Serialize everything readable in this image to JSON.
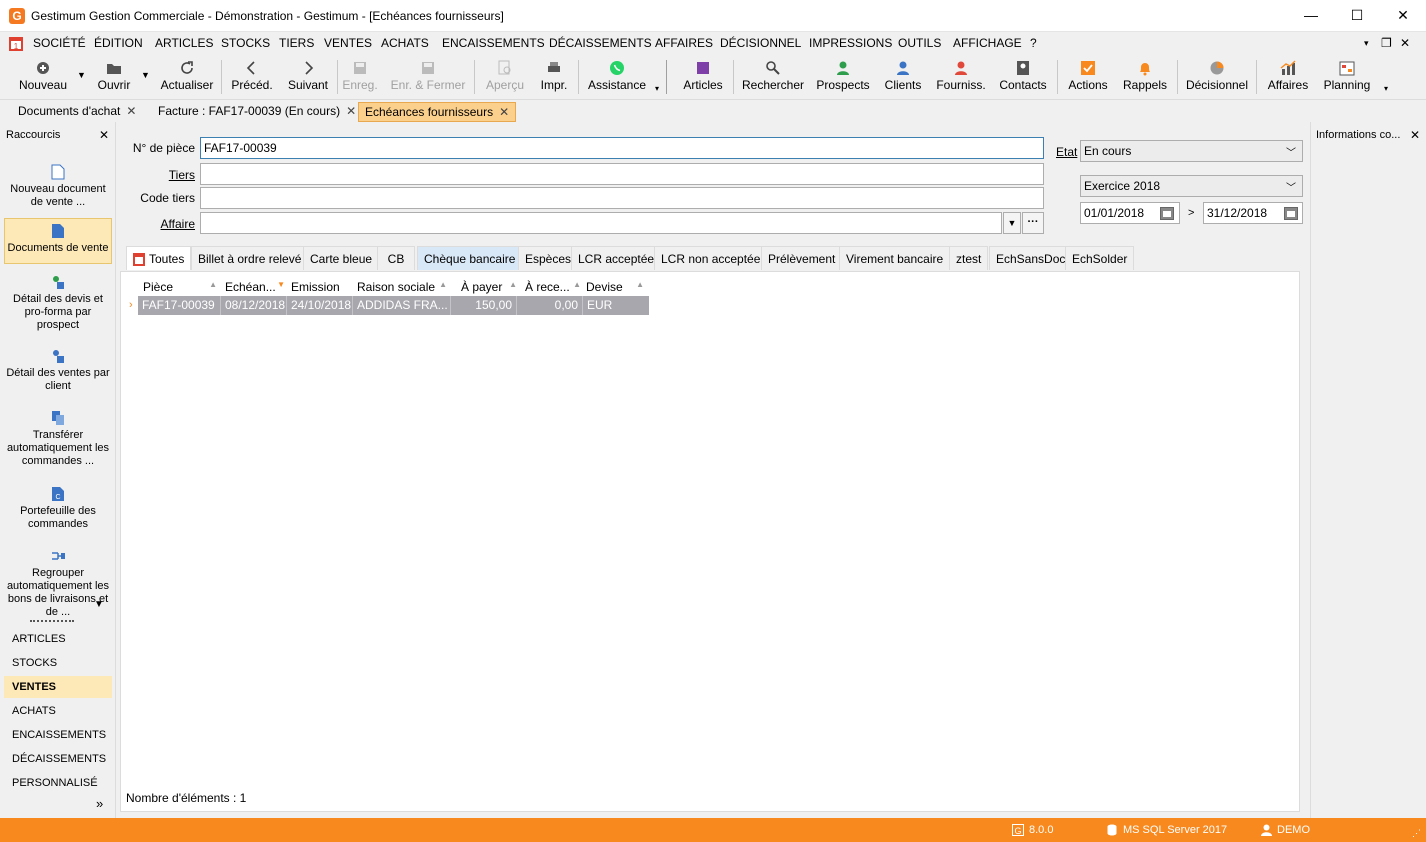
{
  "window": {
    "title": "Gestimum Gestion Commerciale - Démonstration - Gestimum - [Echéances fournisseurs]",
    "logo_letter": "G",
    "minimize": "—",
    "maximize": "☐",
    "close": "✕"
  },
  "menu": {
    "items": [
      "SOCIÉTÉ",
      "ÉDITION",
      "ARTICLES",
      "STOCKS",
      "TIERS",
      "VENTES",
      "ACHATS",
      "ENCAISSEMENTS",
      "DÉCAISSEMENTS",
      "AFFAIRES",
      "DÉCISIONNEL",
      "IMPRESSIONS",
      "OUTILS",
      "AFFICHAGE",
      "?"
    ],
    "right_controls": [
      "▾",
      "❐",
      "✕"
    ]
  },
  "toolbar": {
    "nouveau": "Nouveau",
    "ouvrir": "Ouvrir",
    "actualiser": "Actualiser",
    "preced": "Précéd.",
    "suivant": "Suivant",
    "enreg": "Enreg.",
    "enr_fermer": "Enr. & Fermer",
    "apercu": "Aperçu",
    "impr": "Impr.",
    "assistance": "Assistance",
    "articles": "Articles",
    "rechercher": "Rechercher",
    "prospects": "Prospects",
    "clients": "Clients",
    "fourniss": "Fourniss.",
    "contacts": "Contacts",
    "actions": "Actions",
    "rappels": "Rappels",
    "decisionnel": "Décisionnel",
    "affaires": "Affaires",
    "planning": "Planning"
  },
  "doc_tabs": [
    {
      "label": "Documents d'achat"
    },
    {
      "label": "Facture : FAF17-00039 (En cours)"
    },
    {
      "label": "Echéances fournisseurs"
    }
  ],
  "left_panel": {
    "title": "Raccourcis",
    "shortcuts": [
      "Nouveau document de vente ...",
      "Documents de vente",
      "Détail des devis et pro-forma par prospect",
      "Détail des ventes par client",
      "Transférer automatiquement les commandes ...",
      "Portefeuille des commandes",
      "Regrouper automatiquement les bons de livraisons et de ..."
    ],
    "categories": [
      "ARTICLES",
      "STOCKS",
      "VENTES",
      "ACHATS",
      "ENCAISSEMENTS",
      "DÉCAISSEMENTS",
      "PERSONNALISÉ"
    ],
    "more": "»"
  },
  "form": {
    "piece_label": "N° de pièce",
    "piece_value": "FAF17-00039",
    "tiers_label": "Tiers",
    "tiers_value": "",
    "code_tiers_label": "Code tiers",
    "code_tiers_value": "",
    "affaire_label": "Affaire",
    "affaire_value": "",
    "affaire_more": "···",
    "etat_label": "Etat",
    "etat_value": "En cours",
    "exercice_value": "Exercice 2018",
    "date_from": "01/01/2018",
    "date_sep": ">",
    "date_to": "31/12/2018"
  },
  "grid_tabs": [
    "Toutes",
    "Billet à ordre relevé",
    "Carte bleue",
    "CB",
    "Chèque bancaire",
    "Espèces",
    "LCR acceptée",
    "LCR non acceptée",
    "Prélèvement",
    "Virement bancaire",
    "ztest",
    "EchSansDoc",
    "EchSolder"
  ],
  "grid": {
    "columns": [
      "Pièce",
      "Echéan...",
      "Emission",
      "Raison sociale",
      "À payer",
      "À rece...",
      "Devise"
    ],
    "rows": [
      [
        "FAF17-00039",
        "08/12/2018",
        "24/10/2018",
        "ADDIDAS FRA...",
        "150,00",
        "0,00",
        "EUR"
      ]
    ],
    "footer": "Nombre d'éléments : 1"
  },
  "right_panel": {
    "title": "Informations co..."
  },
  "status": {
    "version": "8.0.0",
    "server": "MS SQL Server 2017",
    "user": "DEMO"
  }
}
